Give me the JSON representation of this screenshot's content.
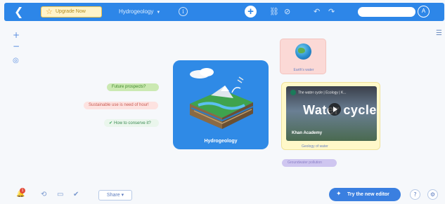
{
  "toolbar": {
    "back_icon": "chevron-left-icon",
    "upgrade_label": "Upgrade Now",
    "map_title": "Hydrogeology",
    "info_icon": "info-icon",
    "add_icon": "plus-icon",
    "undo_icon": "undo-icon",
    "redo_icon": "redo-icon",
    "search_placeholder": "",
    "avatar_initial": "A",
    "accent_color": "#2d86e8"
  },
  "canvas_tools": {
    "zoom_in": "+",
    "zoom_out": "−",
    "center_icon": "target-icon",
    "menu_icon": "hamburger-icon"
  },
  "mindmap": {
    "central_topic": "Hydrogeology",
    "left_topics": [
      {
        "label": "Future prospects?",
        "color": "#cbe9b2"
      },
      {
        "label": "Sustainable use is need of hour!",
        "color": "#fde2e0"
      },
      {
        "label": "How to conserve it?",
        "color": "#eaf6ec"
      }
    ],
    "earth_node_label": "Earth's water",
    "video_node": {
      "header": "The water cycle | Ecology | K...",
      "title_text": "Water cycle",
      "channel": "Khan Academy",
      "label": "Geology of water"
    },
    "bottom_right_pill": "Groundwater pollution"
  },
  "bottombar": {
    "notification_count": "1",
    "share_label": "Share",
    "try_label": "Try the new editor",
    "help_icon": "help-icon",
    "bell_icon": "bell-icon"
  }
}
